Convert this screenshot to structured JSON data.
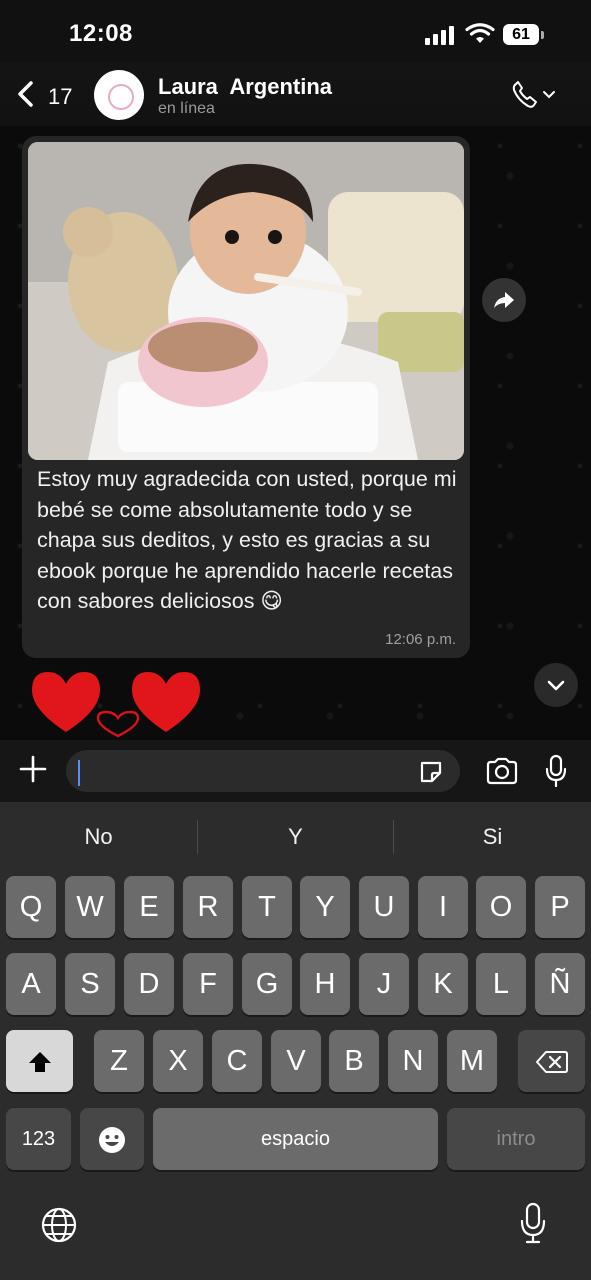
{
  "status_bar": {
    "time": "12:08",
    "battery": "61"
  },
  "header": {
    "back_count": "17",
    "contact_name": "Laura  Argentina",
    "contact_status": "en línea"
  },
  "message": {
    "text": "Estoy muy agradecida con usted, porque mi bebé se come absolutamente todo y se chapa sus deditos, y esto es gracias a su ebook porque he aprendido hacerle recetas con sabores deliciosos 😋",
    "time": "12:06 p.m.",
    "reaction_icons": [
      "heart-icon",
      "heart-icon",
      "heart-outline-icon"
    ]
  },
  "input": {
    "value": "",
    "placeholder": ""
  },
  "keyboard": {
    "suggestions": [
      "No",
      "Y",
      "Si"
    ],
    "row1": [
      "Q",
      "W",
      "E",
      "R",
      "T",
      "Y",
      "U",
      "I",
      "O",
      "P"
    ],
    "row2": [
      "A",
      "S",
      "D",
      "F",
      "G",
      "H",
      "J",
      "K",
      "L",
      "Ñ"
    ],
    "row3": [
      "Z",
      "X",
      "C",
      "V",
      "B",
      "N",
      "M"
    ],
    "numbers_label": "123",
    "space_label": "espacio",
    "return_label": "intro"
  },
  "colors": {
    "bubble": "#262626",
    "accent_cursor": "#5b8cf7",
    "heart": "#e0161b"
  }
}
